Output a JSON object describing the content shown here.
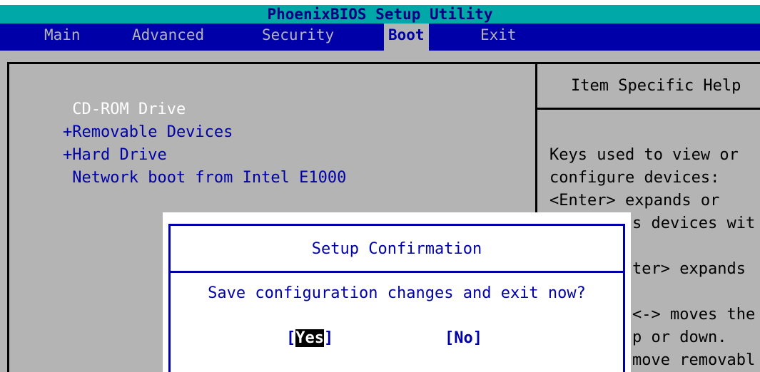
{
  "title": "PhoenixBIOS Setup Utility",
  "menu": [
    {
      "label": "Main"
    },
    {
      "label": "Advanced"
    },
    {
      "label": "Security"
    },
    {
      "label": "Boot"
    },
    {
      "label": "Exit"
    }
  ],
  "active_menu": "Boot",
  "boot_items": [
    {
      "label": " CD-ROM Drive"
    },
    {
      "label": "+Removable Devices"
    },
    {
      "label": "+Hard Drive"
    },
    {
      "label": " Network boot from Intel E1000"
    }
  ],
  "help": {
    "title": "Item Specific Help",
    "lines": [
      "Keys used to view or",
      "configure devices:",
      "<Enter> expands or",
      "s devices wit",
      "ter> expands",
      "<-> moves the",
      "p or down.",
      "move removabl"
    ]
  },
  "dialog": {
    "title": "Setup Confirmation",
    "message": "Save configuration changes and exit now?",
    "yes_open": "[",
    "yes_label": "Yes",
    "yes_close": "]",
    "no_label": "[No]"
  },
  "colors": {
    "title_bg": "#00a8a8",
    "menubar_bg": "#0000a8",
    "panel_bg": "#b4b4b4",
    "accent": "#0000a8"
  }
}
